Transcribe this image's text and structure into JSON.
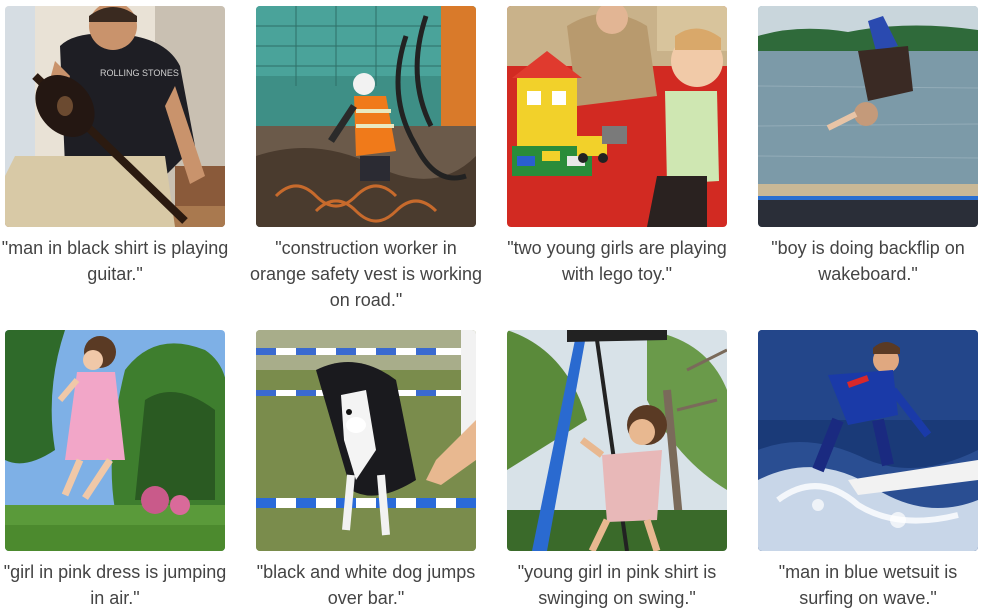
{
  "items": [
    {
      "caption": "\"man in black shirt is playing guitar.\"",
      "shirt_text": "ROLLING STONES"
    },
    {
      "caption": "\"construction worker in orange safety vest is working on road.\""
    },
    {
      "caption": "\"two young girls are playing with lego toy.\""
    },
    {
      "caption": "\"boy is doing backflip on wakeboard.\""
    },
    {
      "caption": "\"girl in pink dress is jumping in air.\""
    },
    {
      "caption": "\"black and white dog jumps over bar.\""
    },
    {
      "caption": "\"young girl in pink shirt is swinging on swing.\""
    },
    {
      "caption": "\"man in blue wetsuit is surfing on wave.\""
    }
  ]
}
